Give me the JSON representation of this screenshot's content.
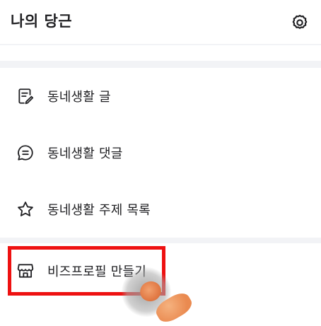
{
  "header": {
    "title": "나의 당근",
    "settings_icon": "gear-icon"
  },
  "menu": {
    "items": [
      {
        "label": "동네생활 글",
        "icon": "edit-note-icon"
      },
      {
        "label": "동네생활 댓글",
        "icon": "comment-icon"
      },
      {
        "label": "동네생활 주제 목록",
        "icon": "star-icon"
      },
      {
        "label": "비즈프로필 만들기",
        "icon": "storefront-icon"
      }
    ]
  },
  "colors": {
    "highlight_border": "#ee1111",
    "section_gap": "#f2f3f6",
    "text": "#212124"
  }
}
